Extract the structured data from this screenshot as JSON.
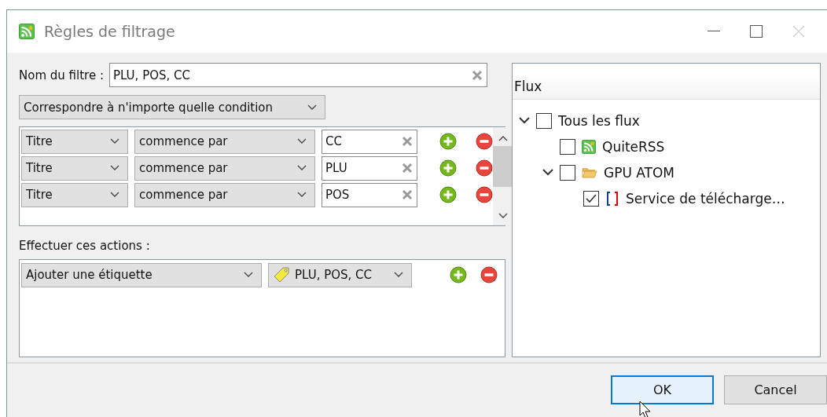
{
  "window": {
    "title": "Règles de filtrage"
  },
  "filter_name": {
    "label": "Nom du filtre :",
    "value": "PLU, POS, CC"
  },
  "match_mode": {
    "value": "Correspondre à n'importe quelle condition"
  },
  "conditions": [
    {
      "field": "Titre",
      "operator": "commence par",
      "value": "CC"
    },
    {
      "field": "Titre",
      "operator": "commence par",
      "value": "PLU"
    },
    {
      "field": "Titre",
      "operator": "commence par",
      "value": "POS"
    }
  ],
  "actions_label": "Effectuer ces actions :",
  "actions": [
    {
      "action": "Ajouter une étiquette",
      "value": "PLU, POS, CC"
    }
  ],
  "feeds": {
    "header": "Flux",
    "tree": [
      {
        "label": "Tous les flux",
        "checked": false,
        "expanded": true,
        "children": [
          {
            "label": "QuiteRSS",
            "kind": "rss",
            "checked": false
          },
          {
            "label": "GPU ATOM",
            "kind": "folder",
            "checked": false,
            "expanded": true,
            "children": [
              {
                "label": "Service de télécharge…",
                "kind": "flag",
                "checked": true
              }
            ]
          }
        ]
      }
    ]
  },
  "buttons": [
    {
      "label": "OK",
      "kind": "default"
    },
    {
      "label": "Cancel",
      "kind": "normal"
    }
  ]
}
